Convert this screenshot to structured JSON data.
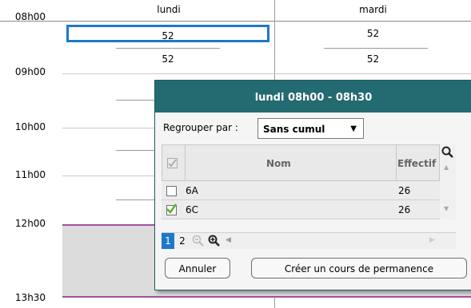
{
  "times": [
    "08h00",
    "09h00",
    "10h00",
    "11h00",
    "12h00",
    "13h30"
  ],
  "days": [
    "lundi",
    "mardi"
  ],
  "grid": {
    "lundi": [
      "52",
      "52"
    ],
    "mardi": [
      "52",
      "52"
    ]
  },
  "dialog": {
    "title": "lundi 08h00 - 08h30",
    "regroup_label": "Regrouper par :",
    "regroup_value": "Sans cumul",
    "columns": {
      "nom": "Nom",
      "effectif": "Effectif"
    },
    "rows": [
      {
        "nom": "6A",
        "effectif": "26",
        "checked": false
      },
      {
        "nom": "6C",
        "effectif": "26",
        "checked": true
      }
    ],
    "pages": [
      "1",
      "2"
    ],
    "cancel_label": "Annuler",
    "create_label": "Créer un cours de permanence"
  },
  "colors": {
    "header": "#246a71",
    "selected": "#1e78c8",
    "purple": "#a0509c",
    "check": "#5ab02f"
  }
}
